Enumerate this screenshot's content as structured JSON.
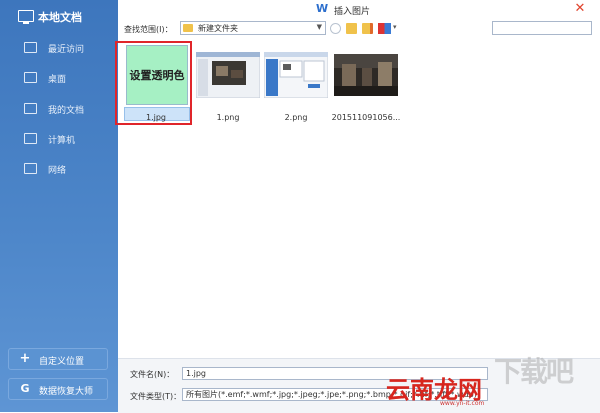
{
  "window": {
    "title": "插入图片"
  },
  "sidebar": {
    "header": "本地文档",
    "items": [
      {
        "label": "最近访问"
      },
      {
        "label": "桌面"
      },
      {
        "label": "我的文档"
      },
      {
        "label": "计算机"
      },
      {
        "label": "网络"
      }
    ],
    "custom_location": "自定义位置",
    "recovery": "数据恢复大师"
  },
  "toolbar": {
    "lookin_label": "查找范围(I)：",
    "current_folder": "新建文件夹"
  },
  "files": [
    {
      "name": "1.jpg",
      "thumb_text": "设置透明色",
      "selected": true
    },
    {
      "name": "1.png"
    },
    {
      "name": "2.png"
    },
    {
      "name": "201511091056..."
    }
  ],
  "bottom": {
    "filename_label": "文件名(N)：",
    "filename_value": "1.jpg",
    "filetype_label": "文件类型(T)：",
    "filetype_value": "所有图片(*.emf;*.wmf;*.jpg;*.jpeg;*.jpe;*.png;*.bmp;*.gif;*.tif;*.tiff;*.wdp)"
  },
  "watermark": {
    "brand": "云南龙网",
    "url": "www.yn-it.com"
  },
  "colors": {
    "sidebar": "#4a82c6",
    "selection_outline": "#e0252a",
    "thumb_green": "#a6f0c4"
  }
}
